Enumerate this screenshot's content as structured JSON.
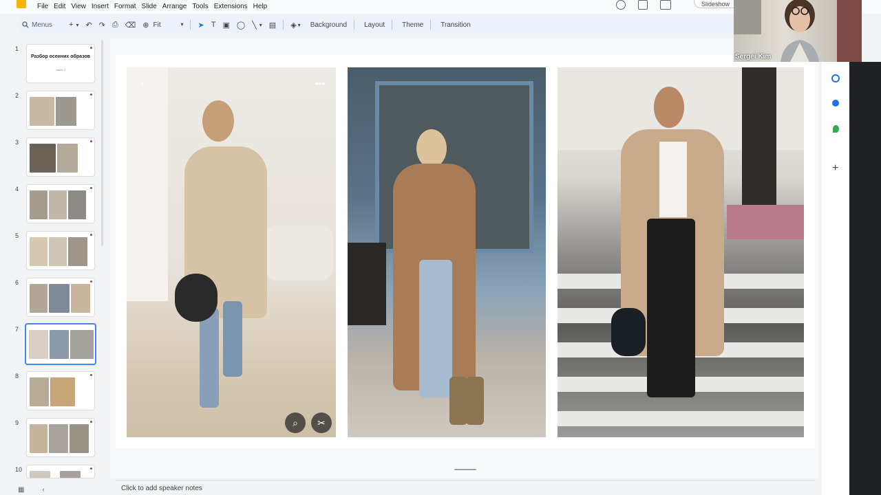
{
  "menu": [
    "File",
    "Edit",
    "View",
    "Insert",
    "Format",
    "Slide",
    "Arrange",
    "Tools",
    "Extensions",
    "Help"
  ],
  "header": {
    "slideshow_label": "Slideshow"
  },
  "toolbar": {
    "search_label": "Menus",
    "zoom_label": "Fit",
    "background_label": "Background",
    "layout_label": "Layout",
    "theme_label": "Theme",
    "transition_label": "Transition"
  },
  "filmstrip": {
    "slides": [
      {
        "number": "1",
        "title": "Разбор осенних образов",
        "subtitle": "Часть 2"
      },
      {
        "number": "2"
      },
      {
        "number": "3"
      },
      {
        "number": "4"
      },
      {
        "number": "5"
      },
      {
        "number": "6"
      },
      {
        "number": "7",
        "selected": true
      },
      {
        "number": "8"
      },
      {
        "number": "9"
      },
      {
        "number": "10"
      }
    ]
  },
  "video": {
    "participant_name": "Sergei Kim"
  },
  "notes": {
    "placeholder": "Click to add speaker notes"
  },
  "icons": {
    "photo_controls": [
      "back-chevron-icon",
      "more-dots-icon",
      "lens-search-icon",
      "scissors-icon"
    ],
    "right_panel": [
      "tasks-icon",
      "contacts-icon",
      "maps-icon",
      "add-icon"
    ]
  },
  "colors": {
    "accent": "#4285f4",
    "app_logo": "#f4b400",
    "marker": "#d93025"
  }
}
